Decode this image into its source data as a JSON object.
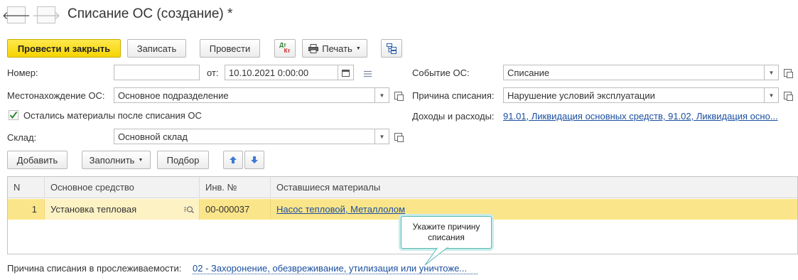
{
  "window": {
    "title": "Списание ОС (создание) *"
  },
  "nav": {
    "back_glyph": "🡐",
    "forward_glyph": "🡒"
  },
  "toolbar": {
    "post_close_label": "Провести и закрыть",
    "save_label": "Записать",
    "post_label": "Провести",
    "dtkt_top": "Дт",
    "dtkt_bottom": "Кт",
    "print_label": "Печать"
  },
  "form": {
    "number_label": "Номер:",
    "number_value": "",
    "date_label": "от:",
    "date_value": "10.10.2021  0:00:00",
    "event_label": "Событие ОС:",
    "event_value": "Списание",
    "location_label": "Местонахождение ОС:",
    "location_value": "Основное подразделение",
    "reason_label": "Причина списания:",
    "reason_value": "Нарушение условий эксплуатации",
    "materials_checkbox_label": "Остались материалы после списания ОС",
    "materials_checked": true,
    "income_label": "Доходы и расходы:",
    "income_value": "91.01, Ликвидация основных средств, 91.02, Ликвидация осно...",
    "warehouse_label": "Склад:",
    "warehouse_value": "Основной склад"
  },
  "table_toolbar": {
    "add_label": "Добавить",
    "fill_label": "Заполнить",
    "select_label": "Подбор"
  },
  "table": {
    "columns": [
      "N",
      "Основное средство",
      "Инв. №",
      "Оставшиеся материалы"
    ],
    "rows": [
      {
        "n": "1",
        "asset": "Установка тепловая",
        "inv": "00-000037",
        "materials": "Насос тепловой, Металлолом"
      }
    ]
  },
  "tooltip": {
    "text": "Укажите причину списания"
  },
  "tracking": {
    "label": "Причина списания в прослеживаемости:",
    "value": "02 - Захоронение, обезвреживание, утилизация или уничтоже..."
  },
  "colors": {
    "primary_button": "#f5d400",
    "selected_row": "#fbe58a",
    "link": "#1a4fa0",
    "tooltip_border": "#56b7b3"
  }
}
